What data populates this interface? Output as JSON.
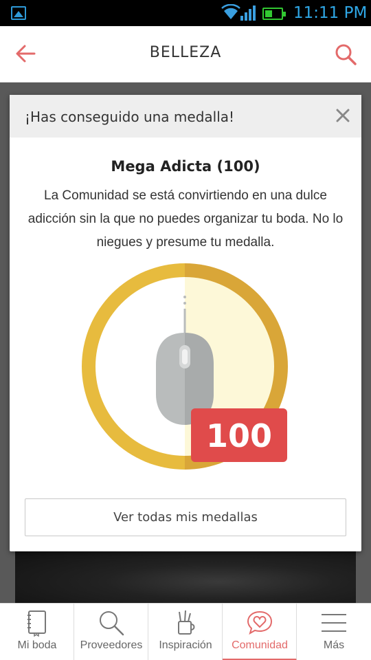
{
  "status_bar": {
    "time": "11:11 PM"
  },
  "app_bar": {
    "title": "BELLEZA"
  },
  "dialog": {
    "header_title": "¡Has conseguido una medalla!",
    "medal_name": "Mega Adicta (100)",
    "description": "La Comunidad se está convirtiendo en una dulce adicción sin la que no puedes organizar tu boda. No lo niegues y presume tu medalla.",
    "badge_count": "100",
    "badge_icon": "mouse-icon",
    "button_label": "Ver todas mis medallas",
    "colors": {
      "ring": "#e7bb3e",
      "badge": "#e04b4b",
      "mouse": "#b9bcbc"
    }
  },
  "bottom_nav": {
    "items": [
      {
        "label": "Mi boda",
        "icon": "notebook-icon"
      },
      {
        "label": "Proveedores",
        "icon": "search-icon"
      },
      {
        "label": "Inspiración",
        "icon": "pencil-cup-icon"
      },
      {
        "label": "Comunidad",
        "icon": "heart-chat-icon",
        "active": true
      },
      {
        "label": "Más",
        "icon": "hamburger-menu-icon"
      }
    ],
    "accent_color": "#e36a6a"
  }
}
